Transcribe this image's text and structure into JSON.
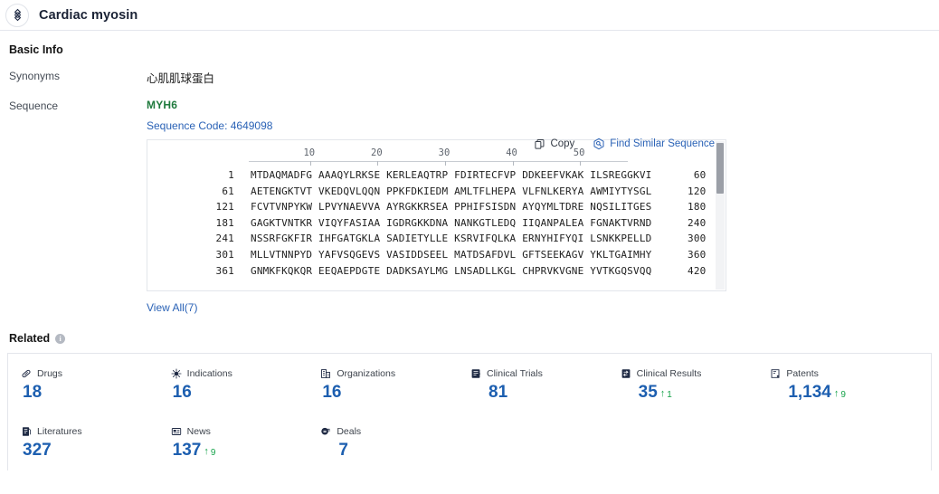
{
  "header": {
    "title": "Cardiac myosin",
    "icon": "target-icon"
  },
  "basic_info": {
    "section_title": "Basic Info",
    "synonyms_label": "Synonyms",
    "synonyms_value": "心肌肌球蛋白",
    "sequence_label": "Sequence",
    "gene_name": "MYH6",
    "sequence_code": "Sequence Code: 4649098",
    "copy_label": "Copy",
    "find_similar_label": "Find Similar Sequence",
    "view_all_label": "View All(7)"
  },
  "sequence_viewer": {
    "ruler_ticks": [
      "10",
      "20",
      "30",
      "40",
      "50"
    ],
    "rows": [
      {
        "start": "1",
        "body": "MTDAQMADFG AAAQYLRKSE KERLEAQTRP FDIRTECFVP DDKEEFVKAK ILSREGGKVI",
        "end": "60"
      },
      {
        "start": "61",
        "body": "AETENGKTVT VKEDQVLQQN PPKFDKIEDM AMLTFLHEPA VLFNLKERYA AWMIYTYSGL",
        "end": "120"
      },
      {
        "start": "121",
        "body": "FCVTVNPYKW LPVYNAEVVA AYRGKKRSEA PPHIFSISDN AYQYMLTDRE NQSILITGES",
        "end": "180"
      },
      {
        "start": "181",
        "body": "GAGKTVNTKR VIQYFASIAA IGDRGKKDNA NANKGTLEDQ IIQANPALEA FGNAKTVRND",
        "end": "240"
      },
      {
        "start": "241",
        "body": "NSSRFGKFIR IHFGATGKLA SADIETYLLE KSRVIFQLKA ERNYHIFYQI LSNKKPELLD",
        "end": "300"
      },
      {
        "start": "301",
        "body": "MLLVTNNPYD YAFVSQGEVS VASIDDSEEL MATDSAFDVL GFTSEEKAGV YKLTGAIMHY",
        "end": "360"
      },
      {
        "start": "361",
        "body": "GNMKFKQKQR EEQAEPDGTE DADKSAYLMG LNSADLLKGL CHPRVKVGNE YVTKGQSVQQ",
        "end": "420"
      }
    ]
  },
  "related": {
    "title": "Related",
    "info_tooltip": "i",
    "tiles": [
      {
        "icon": "pill-icon",
        "label": "Drugs",
        "value": "18",
        "delta": null,
        "indent": false
      },
      {
        "icon": "virus-icon",
        "label": "Indications",
        "value": "16",
        "delta": null,
        "indent": false
      },
      {
        "icon": "organization-icon",
        "label": "Organizations",
        "value": "16",
        "delta": null,
        "indent": false
      },
      {
        "icon": "clinical-trial-icon",
        "label": "Clinical Trials",
        "value": "81",
        "delta": null,
        "indent": true
      },
      {
        "icon": "clinical-result-icon",
        "label": "Clinical Results",
        "value": "35",
        "delta": "1",
        "indent": true
      },
      {
        "icon": "patent-icon",
        "label": "Patents",
        "value": "1,134",
        "delta": "9",
        "indent": true
      },
      {
        "icon": "literature-icon",
        "label": "Literatures",
        "value": "327",
        "delta": null,
        "indent": false
      },
      {
        "icon": "news-icon",
        "label": "News",
        "value": "137",
        "delta": "9",
        "indent": false
      },
      {
        "icon": "deals-icon",
        "label": "Deals",
        "value": "7",
        "delta": null,
        "indent": true
      }
    ]
  },
  "colors": {
    "accent_blue": "#1d5fb0",
    "link_blue": "#2a62b6",
    "gene_green": "#1f7a3d",
    "delta_green": "#16a34a"
  }
}
